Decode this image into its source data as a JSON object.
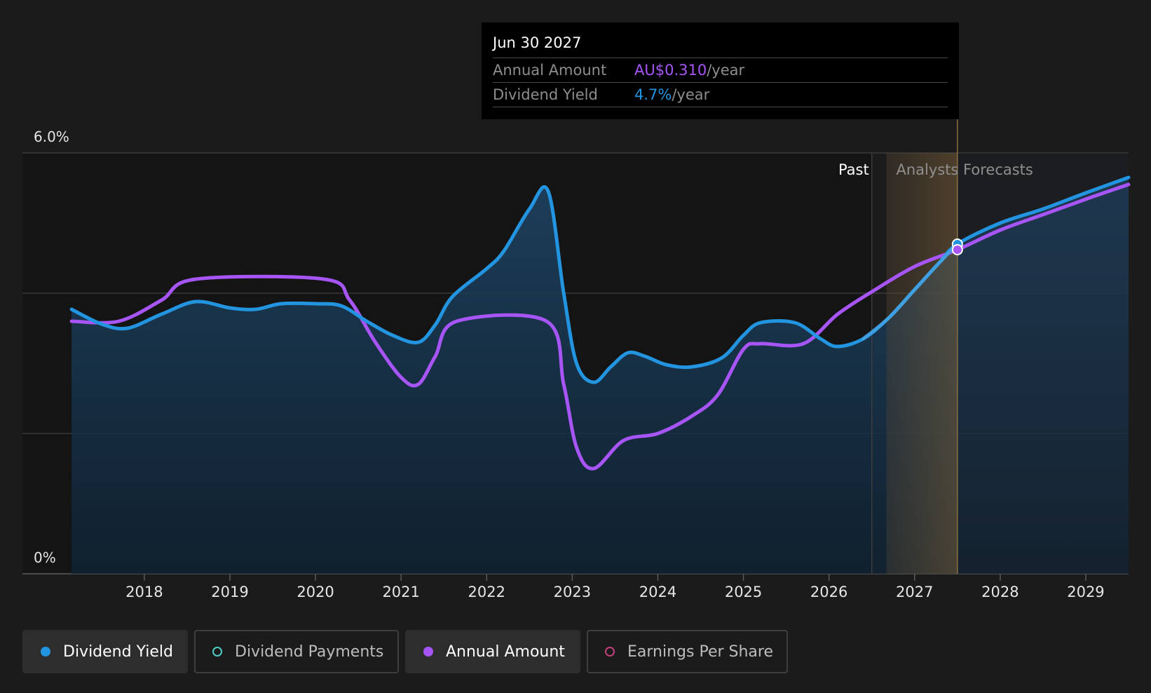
{
  "tooltip": {
    "date": "Jun 30 2027",
    "rows": [
      {
        "label": "Annual Amount",
        "value": "AU$0.310",
        "unit": "/year",
        "color": "#a855f7"
      },
      {
        "label": "Dividend Yield",
        "value": "4.7%",
        "unit": "/year",
        "color": "#2394df"
      }
    ]
  },
  "legend": [
    {
      "label": "Dividend Yield",
      "color": "#2394df",
      "filled": true,
      "active": true
    },
    {
      "label": "Dividend Payments",
      "color": "#4ecdc4",
      "filled": false,
      "active": false
    },
    {
      "label": "Annual Amount",
      "color": "#a855f7",
      "filled": true,
      "active": true
    },
    {
      "label": "Earnings Per Share",
      "color": "#c0407a",
      "filled": false,
      "active": false
    }
  ],
  "chart_data": {
    "type": "line",
    "ylim": [
      0,
      6.0
    ],
    "y_tick_labels": [
      "6.0%",
      "0%"
    ],
    "xlim": [
      2017.1,
      2029.5
    ],
    "x_ticks": [
      2018,
      2019,
      2020,
      2021,
      2022,
      2023,
      2024,
      2025,
      2026,
      2027,
      2028,
      2029
    ],
    "regions": {
      "past_label": "Past",
      "forecast_label": "Analysts Forecasts",
      "past_end": 2026.5,
      "forecast_start": 2026.67
    },
    "highlight_x": 2027.5,
    "series": [
      {
        "name": "Dividend Yield",
        "color": "#2394df",
        "fill": true,
        "points": [
          [
            2017.15,
            3.77
          ],
          [
            2017.5,
            3.56
          ],
          [
            2017.8,
            3.5
          ],
          [
            2018.2,
            3.7
          ],
          [
            2018.6,
            3.88
          ],
          [
            2019.0,
            3.79
          ],
          [
            2019.3,
            3.77
          ],
          [
            2019.6,
            3.85
          ],
          [
            2020.0,
            3.85
          ],
          [
            2020.3,
            3.82
          ],
          [
            2020.6,
            3.6
          ],
          [
            2020.9,
            3.4
          ],
          [
            2021.2,
            3.3
          ],
          [
            2021.4,
            3.55
          ],
          [
            2021.6,
            3.95
          ],
          [
            2022.0,
            4.35
          ],
          [
            2022.2,
            4.6
          ],
          [
            2022.5,
            5.2
          ],
          [
            2022.72,
            5.45
          ],
          [
            2022.9,
            4.0
          ],
          [
            2023.05,
            3.0
          ],
          [
            2023.25,
            2.73
          ],
          [
            2023.45,
            2.95
          ],
          [
            2023.65,
            3.15
          ],
          [
            2023.85,
            3.1
          ],
          [
            2024.1,
            2.98
          ],
          [
            2024.4,
            2.95
          ],
          [
            2024.75,
            3.08
          ],
          [
            2025.0,
            3.4
          ],
          [
            2025.2,
            3.58
          ],
          [
            2025.6,
            3.58
          ],
          [
            2025.9,
            3.35
          ],
          [
            2026.1,
            3.24
          ],
          [
            2026.4,
            3.35
          ],
          [
            2026.7,
            3.65
          ],
          [
            2027.0,
            4.05
          ],
          [
            2027.3,
            4.45
          ],
          [
            2027.5,
            4.7
          ],
          [
            2028.0,
            5.0
          ],
          [
            2028.5,
            5.2
          ],
          [
            2029.0,
            5.43
          ],
          [
            2029.5,
            5.65
          ]
        ]
      },
      {
        "name": "Annual Amount",
        "color": "#a855f7",
        "fill": false,
        "points": [
          [
            2017.15,
            3.6
          ],
          [
            2017.7,
            3.6
          ],
          [
            2018.2,
            3.9
          ],
          [
            2018.6,
            4.2
          ],
          [
            2020.1,
            4.2
          ],
          [
            2020.4,
            3.9
          ],
          [
            2020.7,
            3.3
          ],
          [
            2021.0,
            2.8
          ],
          [
            2021.2,
            2.7
          ],
          [
            2021.4,
            3.1
          ],
          [
            2021.65,
            3.6
          ],
          [
            2022.7,
            3.6
          ],
          [
            2022.9,
            2.7
          ],
          [
            2023.05,
            1.8
          ],
          [
            2023.25,
            1.5
          ],
          [
            2023.6,
            1.9
          ],
          [
            2024.0,
            2.0
          ],
          [
            2024.4,
            2.25
          ],
          [
            2024.7,
            2.55
          ],
          [
            2025.0,
            3.2
          ],
          [
            2025.2,
            3.28
          ],
          [
            2025.7,
            3.28
          ],
          [
            2026.1,
            3.7
          ],
          [
            2026.5,
            4.02
          ],
          [
            2027.0,
            4.38
          ],
          [
            2027.5,
            4.62
          ],
          [
            2028.0,
            4.9
          ],
          [
            2028.5,
            5.12
          ],
          [
            2029.0,
            5.34
          ],
          [
            2029.5,
            5.55
          ]
        ]
      }
    ]
  }
}
